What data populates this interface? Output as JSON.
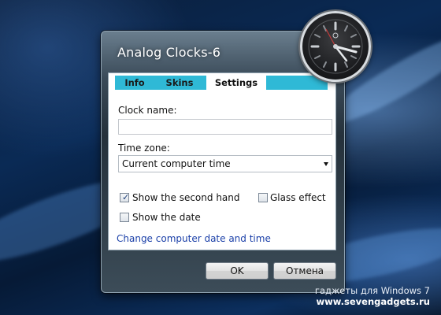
{
  "dialog": {
    "title": "Analog Clocks-6",
    "tabs": [
      {
        "label": "Info"
      },
      {
        "label": "Skins"
      },
      {
        "label": "Settings",
        "selected": true
      }
    ],
    "clock_name": {
      "label": "Clock name:",
      "value": ""
    },
    "time_zone": {
      "label": "Time zone:",
      "selected": "Current computer time"
    },
    "show_second_hand": {
      "label": "Show the second hand",
      "checked": true
    },
    "glass_effect": {
      "label": "Glass effect",
      "checked": false
    },
    "show_date": {
      "label": "Show the date",
      "checked": false
    },
    "change_link": "Change computer date and time",
    "ok_label": "OK",
    "cancel_label": "Отмена"
  },
  "clock_widget": {
    "icon": "analog-clock-icon"
  },
  "footer": {
    "line1": "гаджеты для Windows 7",
    "line2": "www.sevengadgets.ru"
  },
  "colors": {
    "tab_strip": "#2fb9d6",
    "link": "#1a3fa8"
  }
}
